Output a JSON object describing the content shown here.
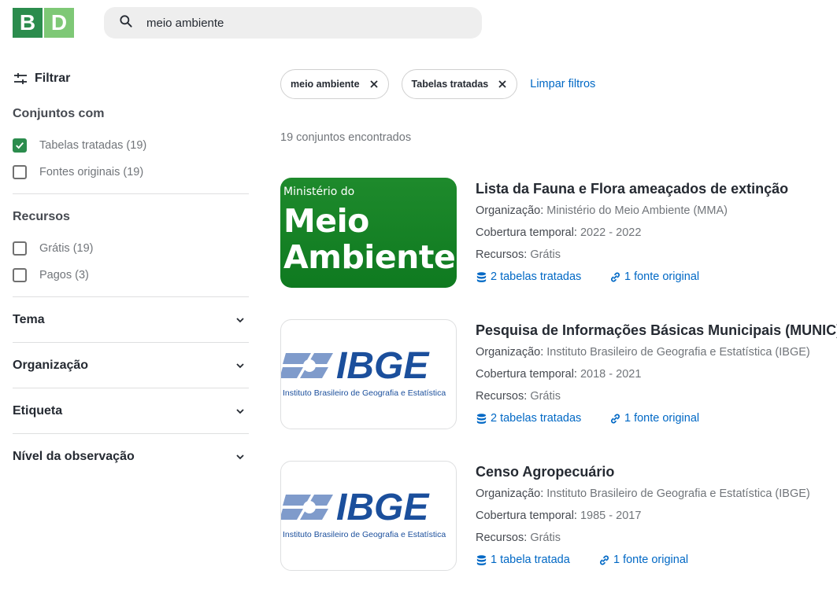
{
  "header": {
    "logo_b": "B",
    "logo_d": "D",
    "search_value": "meio ambiente"
  },
  "sidebar": {
    "filter_label": "Filtrar",
    "conjuntos_title": "Conjuntos com",
    "conjuntos_options": [
      {
        "label": "Tabelas tratadas (19)",
        "checked": true
      },
      {
        "label": "Fontes originais (19)",
        "checked": false
      }
    ],
    "recursos_title": "Recursos",
    "recursos_options": [
      {
        "label": "Grátis (19)",
        "checked": false
      },
      {
        "label": "Pagos (3)",
        "checked": false
      }
    ],
    "accordions": [
      "Tema",
      "Organização",
      "Etiqueta",
      "Nível da observação"
    ]
  },
  "chips": [
    {
      "label": "meio ambiente"
    },
    {
      "label": "Tabelas tratadas"
    }
  ],
  "clear_filters": "Limpar filtros",
  "results_count": "19 conjuntos encontrados",
  "labels": {
    "org": "Organização:",
    "coverage": "Cobertura temporal:",
    "resources": "Recursos:"
  },
  "results": [
    {
      "title": "Lista da Fauna e Flora ameaçados de extinção",
      "org": "Ministério do Meio Ambiente (MMA)",
      "coverage": "2022 - 2022",
      "resources": "Grátis",
      "tables": "2 tabelas tratadas",
      "sources": "1 fonte original",
      "thumb": {
        "small": "Ministério do",
        "line1": "Meio",
        "line2": "Ambiente"
      }
    },
    {
      "title": "Pesquisa de Informações Básicas Municipais (MUNIC)",
      "org": "Instituto Brasileiro de Geografia e Estatística (IBGE)",
      "coverage": "2018 - 2021",
      "resources": "Grátis",
      "tables": "2 tabelas tratadas",
      "sources": "1 fonte original",
      "thumb": {
        "logo": "IBGE",
        "sub": "Instituto Brasileiro de Geografia e Estatística"
      }
    },
    {
      "title": "Censo Agropecuário",
      "org": "Instituto Brasileiro de Geografia e Estatística (IBGE)",
      "coverage": "1985 - 2017",
      "resources": "Grátis",
      "tables": "1 tabela tratada",
      "sources": "1 fonte original",
      "thumb": {
        "logo": "IBGE",
        "sub": "Instituto Brasileiro de Geografia e Estatística"
      }
    }
  ],
  "colors": {
    "brand_green": "#2b8c4d",
    "brand_light_green": "#7ec876",
    "link_blue": "#0068c5",
    "ibge_blue": "#1b4f9c",
    "ibge_light": "#7f9bcb"
  }
}
